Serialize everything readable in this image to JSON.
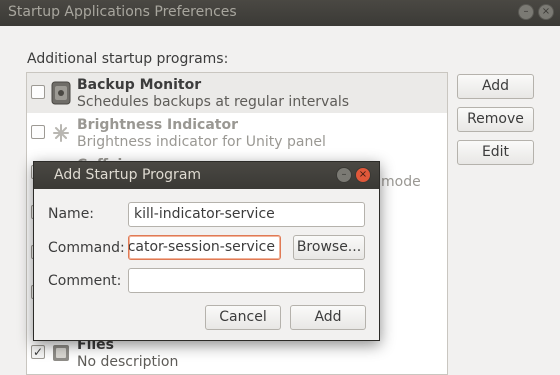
{
  "window": {
    "title": "Startup Applications Preferences",
    "section_label": "Additional startup programs:"
  },
  "programs": [
    {
      "name": "Backup Monitor",
      "description": "Schedules backups at regular intervals",
      "checked": false,
      "icon": "backup-icon"
    },
    {
      "name": "Brightness Indicator",
      "description": "Brightness indicator for Unity panel",
      "checked": false,
      "icon": "brightness-icon"
    },
    {
      "name": "Caffeine",
      "description": "mode",
      "checked": false,
      "icon": "caffeine-icon"
    },
    {
      "name": "",
      "description": "",
      "checked": true,
      "icon": "app-icon"
    },
    {
      "name": "",
      "description": "",
      "checked": true,
      "icon": "app-icon"
    },
    {
      "name": "",
      "description": "",
      "checked": true,
      "icon": "app-icon"
    },
    {
      "name": "Files",
      "description": "No description",
      "checked": true,
      "icon": "files-icon"
    }
  ],
  "side_buttons": {
    "add": "Add",
    "remove": "Remove",
    "edit": "Edit"
  },
  "dialog": {
    "title": "Add Startup Program",
    "name_label": "Name:",
    "name_value": "kill-indicator-service",
    "command_label": "Command:",
    "command_value": "kill-indicator-session-service",
    "browse_label": "Browse...",
    "comment_label": "Comment:",
    "comment_value": "",
    "cancel_label": "Cancel",
    "add_label": "Add"
  },
  "colors": {
    "accent": "#e07a55",
    "close_button": "#e0583a",
    "titlebar": "#3b3a36"
  }
}
